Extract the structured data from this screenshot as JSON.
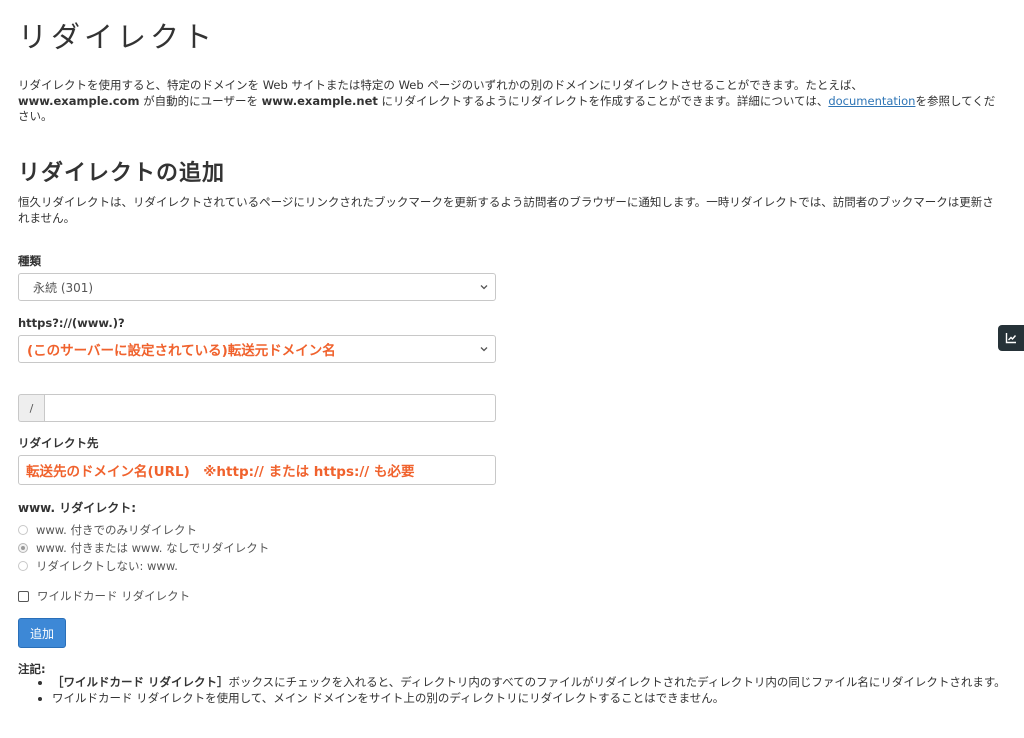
{
  "page": {
    "title": "リダイレクト",
    "intro": {
      "part1": "リダイレクトを使用すると、特定のドメインを Web サイトまたは特定の Web ページのいずれかの別のドメインにリダイレクトさせることができます。たとえば、",
      "domain_from": "www.example.com",
      "part2": " が自動的にユーザーを ",
      "domain_to": "www.example.net",
      "part3": " にリダイレクトするようにリダイレクトを作成することができます。詳細については、",
      "doc_link": "documentation",
      "part4": "を参照してください。"
    }
  },
  "add": {
    "title": "リダイレクトの追加",
    "description": "恒久リダイレクトは、リダイレクトされているページにリンクされたブックマークを更新するよう訪問者のブラウザーに通知します。一時リダイレクトでは、訪問者のブックマークは更新されません。",
    "type": {
      "label": "種類",
      "selected": "永続 (301)"
    },
    "domain": {
      "label": "https?://(www.)?",
      "selected": "(このサーバーに設定されている)転送元ドメイン名"
    },
    "path": {
      "prefix": "/",
      "value": ""
    },
    "target": {
      "label": "リダイレクト先",
      "value": "転送先のドメイン名(URL)　※http:// または https:// も必要"
    },
    "www": {
      "label": "www. リダイレクト:",
      "options": [
        {
          "label": "www. 付きでのみリダイレクト",
          "checked": false
        },
        {
          "label": "www. 付きまたは www. なしでリダイレクト",
          "checked": true
        },
        {
          "label": "リダイレクトしない: www.",
          "checked": false
        }
      ]
    },
    "wildcard": {
      "label": "ワイルドカード リダイレクト",
      "checked": false
    },
    "submit_label": "追加"
  },
  "notes": {
    "title": "注記:",
    "items": [
      {
        "bold": "［ワイルドカード リダイレクト］",
        "text": "ボックスにチェックを入れると、ディレクトリ内のすべてのファイルがリダイレクトされたディレクトリ内の同じファイル名にリダイレクトされます。"
      },
      {
        "bold": "",
        "text": "ワイルドカード リダイレクトを使用して、メイン ドメインをサイト上の別のディレクトリにリダイレクトすることはできません。"
      }
    ]
  },
  "colors": {
    "accent": "#3d88d6",
    "annotation": "#f0622d",
    "link": "#2e75b6",
    "side_tab": "#263238"
  },
  "icons": {
    "select_arrow": "chevron-down-icon",
    "side_tab": "chart-line-icon"
  }
}
